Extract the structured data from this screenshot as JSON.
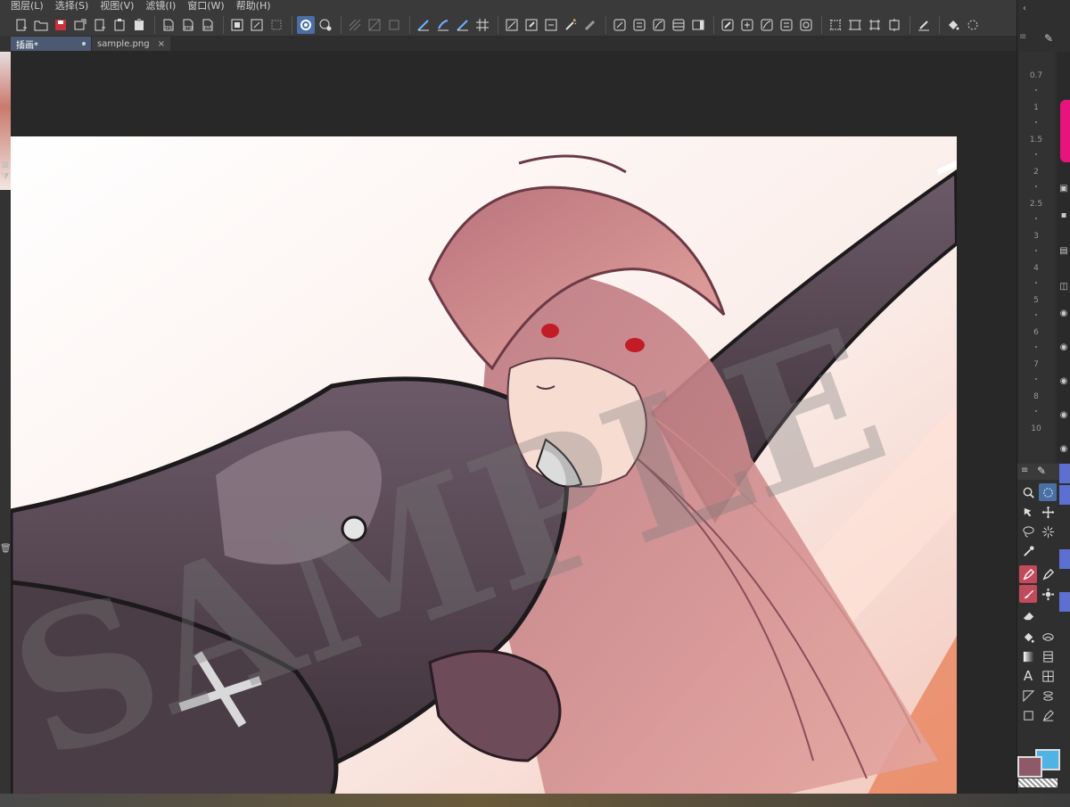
{
  "menu": {
    "items": [
      {
        "label": "图层(L)"
      },
      {
        "label": "选择(S)"
      },
      {
        "label": "视图(V)"
      },
      {
        "label": "滤镜(I)"
      },
      {
        "label": "窗口(W)"
      },
      {
        "label": "帮助(H)"
      }
    ]
  },
  "tabs": [
    {
      "label": "插画*",
      "modified": true
    },
    {
      "label": "sample.png",
      "close": "×"
    }
  ],
  "ruler": {
    "labels": [
      "0.7",
      "1",
      "1.5",
      "2",
      "2.5",
      "3",
      "4",
      "5",
      "6",
      "7",
      "8",
      "10"
    ]
  },
  "canvas": {
    "watermark": "SAMPLE"
  },
  "colors": {
    "main_color": "#8e5a67",
    "sub_color": "#4fb3e3",
    "accent": "#4a6fa5",
    "brush_preview": "#e7147e"
  },
  "tools": [
    {
      "name": "zoom-tool"
    },
    {
      "name": "select-tool"
    },
    {
      "name": "move-layer-tool"
    },
    {
      "name": "move-tool"
    },
    {
      "name": "lasso-tool"
    },
    {
      "name": "auto-select-tool"
    },
    {
      "name": "eyedropper-tool"
    },
    {
      "name": "pen-tool"
    },
    {
      "name": "pencil-tool"
    },
    {
      "name": "brush-tool"
    },
    {
      "name": "decoration-tool"
    },
    {
      "name": "eraser-tool"
    },
    {
      "name": "fill-tool"
    },
    {
      "name": "blend-tool"
    },
    {
      "name": "gradient-tool"
    },
    {
      "name": "figure-tool"
    },
    {
      "name": "text-tool"
    },
    {
      "name": "frame-tool"
    },
    {
      "name": "balloon-tool"
    },
    {
      "name": "ruler-tool"
    },
    {
      "name": "correct-line-tool"
    },
    {
      "name": "operation-tool"
    }
  ]
}
